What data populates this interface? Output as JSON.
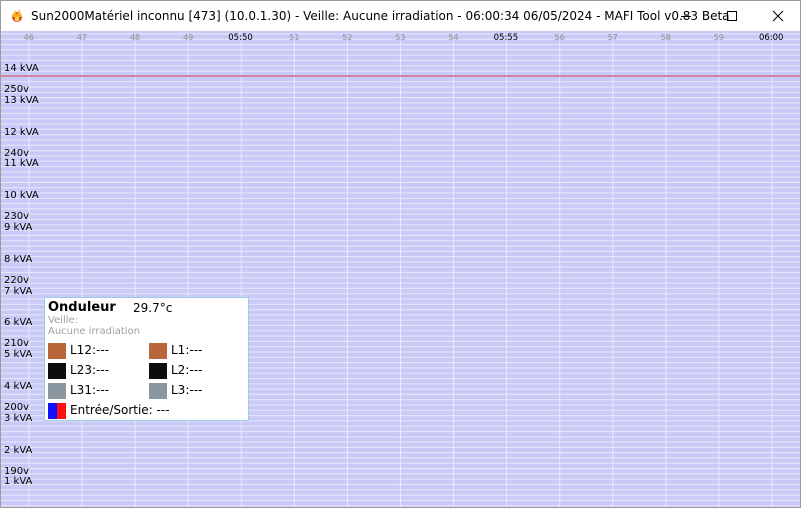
{
  "window": {
    "title": "Sun2000Matériel inconnu [473] (10.0.1.30) - Veille: Aucune irradiation - 06:00:34 06/05/2024 - MAFI Tool v0.83 Beta",
    "app_icon": "flame-logo-icon",
    "controls": {
      "minimize": "—",
      "maximize": "☐",
      "close": "✕"
    }
  },
  "chart_data": {
    "type": "line",
    "x_axis_labels": [
      "46",
      "47",
      "48",
      "49",
      "05:50",
      "51",
      "52",
      "53",
      "54",
      "05:55",
      "56",
      "57",
      "58",
      "59",
      "06:00"
    ],
    "y_labels_power": [
      "14 kVA",
      "13 kVA",
      "12 kVA",
      "11 kVA",
      "10 kVA",
      "9 kVA",
      "8 kVA",
      "7 kVA",
      "6 kVA",
      "5 kVA",
      "4 kVA",
      "3 kVA",
      "2 kVA",
      "1 kVA"
    ],
    "y_labels_voltage": [
      "250v",
      "240v",
      "230v",
      "220v",
      "210v",
      "200v",
      "190v"
    ],
    "grid": true,
    "background_color": "#c9c9f7",
    "limit_line_color": "#d06a8a",
    "series": []
  },
  "legend": {
    "title": "Onduleur",
    "temperature": "29.7°c",
    "status_line1": "Veille:",
    "status_line2": "Aucune irradiation",
    "items": [
      {
        "label": "L12:---",
        "color": "#b8663a"
      },
      {
        "label": "L1:---",
        "color": "#b8663a"
      },
      {
        "label": "L23:---",
        "color": "#0d0d0d"
      },
      {
        "label": "L2:---",
        "color": "#0d0d0d"
      },
      {
        "label": "L31:---",
        "color": "#8a96a0"
      },
      {
        "label": "L3:---",
        "color": "#8a96a0"
      }
    ],
    "io_label": "Entrée/Sortie: ---",
    "io_colors": [
      "#1010ff",
      "#ff1010"
    ]
  }
}
